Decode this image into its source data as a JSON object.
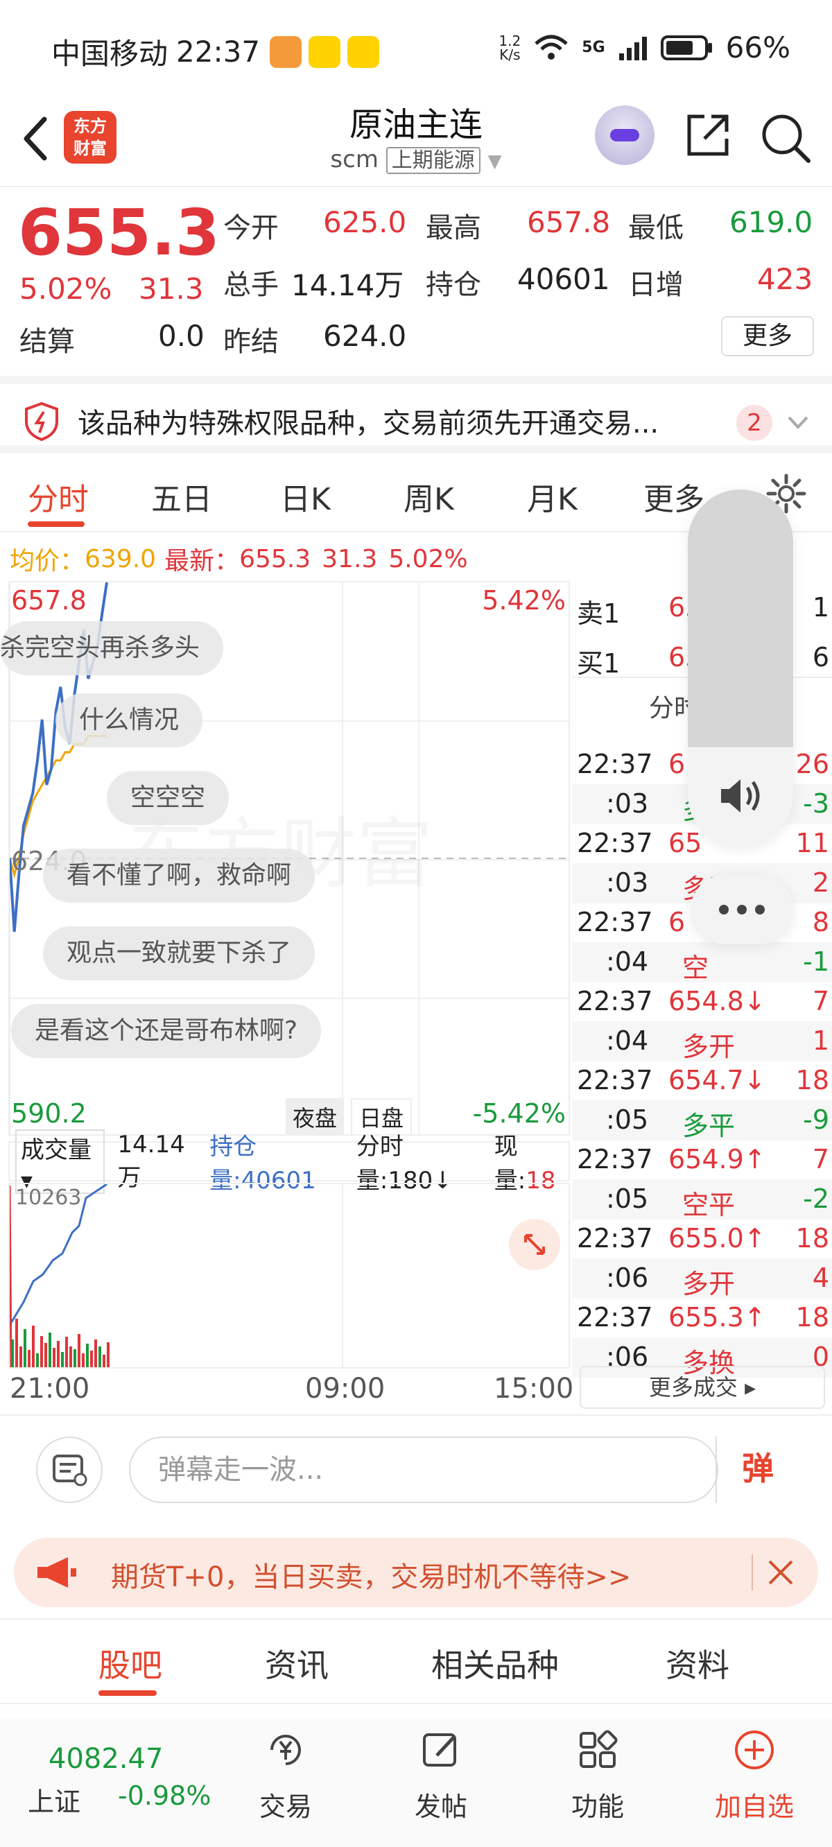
{
  "status_bar": {
    "carrier": "中国移动",
    "time": "22:37",
    "speed_top": "1.2",
    "speed_bottom": "K/s",
    "network": "5G",
    "battery": "66%"
  },
  "header": {
    "logo_line1": "东方",
    "logo_line2": "财富",
    "title": "原油主连",
    "code": "scm",
    "exchange": "上期能源"
  },
  "quote": {
    "price": "655.3",
    "change_pct": "5.02%",
    "change": "31.3",
    "labels": {
      "open": "今开",
      "high": "最高",
      "low": "最低",
      "volume": "总手",
      "position": "持仓",
      "daily_incr": "日增",
      "settle": "结算",
      "prev_settle": "昨结"
    },
    "values": {
      "open": "625.0",
      "high": "657.8",
      "low": "619.0",
      "volume": "14.14万",
      "position": "40601",
      "daily_incr": "423",
      "settle": "0.0",
      "prev_settle": "624.0"
    },
    "more_label": "更多"
  },
  "notice": {
    "text": "该品种为特殊权限品种，交易前须先开通交易...",
    "badge": "2"
  },
  "tabs": [
    "分时",
    "五日",
    "日K",
    "周K",
    "月K",
    "更多"
  ],
  "avg_line": {
    "avg_label": "均价：",
    "avg_value": "639.0",
    "latest_label": "最新：",
    "latest_value": "655.3",
    "latest_change": "31.3",
    "latest_pct": "5.02%"
  },
  "chart": {
    "y_top": "657.8",
    "y_mid": "624.0",
    "y_bottom": "590.2",
    "pct_top": "5.42%",
    "pct_bottom": "-5.42%",
    "session_night": "夜盘",
    "session_day": "日盘",
    "watermark": "东方财富",
    "danmu": [
      "杀完空头再杀多头",
      "什么情况",
      "空空空",
      "看不懂了啊，救命啊",
      "观点一致就要下杀了",
      "是看这个还是哥布林啊?"
    ],
    "price_series": [
      624.0,
      615,
      622,
      628,
      630,
      632,
      636,
      641,
      633,
      635,
      642,
      645,
      640,
      638,
      644,
      648,
      652,
      646,
      648,
      650,
      654,
      657.8
    ],
    "avg_series": [
      624.0,
      622,
      624,
      627,
      629,
      631,
      632,
      633,
      634,
      635,
      636,
      636,
      637,
      637,
      638,
      638,
      638,
      639,
      639,
      639,
      639,
      639.0
    ]
  },
  "volume_bar": {
    "selector": "成交量",
    "volume": "14.14万",
    "position_label": "持仓量:",
    "position_value": "40601",
    "tick_label": "分时量:180",
    "now_label": "现量:",
    "now_value": "18",
    "axis_label": "10263",
    "time_ticks": [
      "21:00",
      "09:00",
      "15:00"
    ]
  },
  "orderbook": {
    "sell1_label": "卖1",
    "sell1_price": "65",
    "sell1_vol": "1",
    "buy1_label": "买1",
    "buy1_price": "65",
    "buy1_vol": "6",
    "header": "分时"
  },
  "trades": [
    {
      "t": "22:37",
      "p": "6",
      "v": "26",
      "pc": "red"
    },
    {
      "t": ":03",
      "p": "多",
      "v": "-3",
      "pc": "green"
    },
    {
      "t": "22:37",
      "p": "65",
      "v": "11",
      "pc": "red"
    },
    {
      "t": ":03",
      "p": "多开",
      "v": "2",
      "pc": "red"
    },
    {
      "t": "22:37",
      "p": "6",
      "v": "8",
      "pc": "red"
    },
    {
      "t": ":04",
      "p": "空",
      "v": "-1",
      "pc": "red"
    },
    {
      "t": "22:37",
      "p": "654.8↓",
      "v": "7",
      "pc": "red"
    },
    {
      "t": ":04",
      "p": "多开",
      "v": "1",
      "pc": "red"
    },
    {
      "t": "22:37",
      "p": "654.7↓",
      "v": "18",
      "pc": "red"
    },
    {
      "t": ":05",
      "p": "多平",
      "v": "-9",
      "pc": "green"
    },
    {
      "t": "22:37",
      "p": "654.9↑",
      "v": "7",
      "pc": "red"
    },
    {
      "t": ":05",
      "p": "空平",
      "v": "-2",
      "pc": "red"
    },
    {
      "t": "22:37",
      "p": "655.0↑",
      "v": "18",
      "pc": "red"
    },
    {
      "t": ":06",
      "p": "多开",
      "v": "4",
      "pc": "red"
    },
    {
      "t": "22:37",
      "p": "655.3↑",
      "v": "18",
      "pc": "red"
    },
    {
      "t": ":06",
      "p": "多换",
      "v": "0",
      "pc": "red"
    }
  ],
  "more_trades": "更多成交",
  "comment_bar": {
    "placeholder": "弹幕走一波...",
    "danmu_button": "弹"
  },
  "promo": {
    "text": "期货T+0，当日买卖，交易时机不等待>>"
  },
  "bottom_tabs": [
    "股吧",
    "资讯",
    "相关品种",
    "资料"
  ],
  "nav": {
    "index_value": "4082.47",
    "index_name": "上证",
    "index_change": "-0.98%",
    "trade": "交易",
    "post": "发帖",
    "func": "功能",
    "add": "加自选"
  },
  "colors": {
    "up": "#e0353a",
    "down": "#1a9a3c",
    "brand": "#e8442e",
    "price_line": "#3d6fc4",
    "avg_line": "#f0a400"
  }
}
